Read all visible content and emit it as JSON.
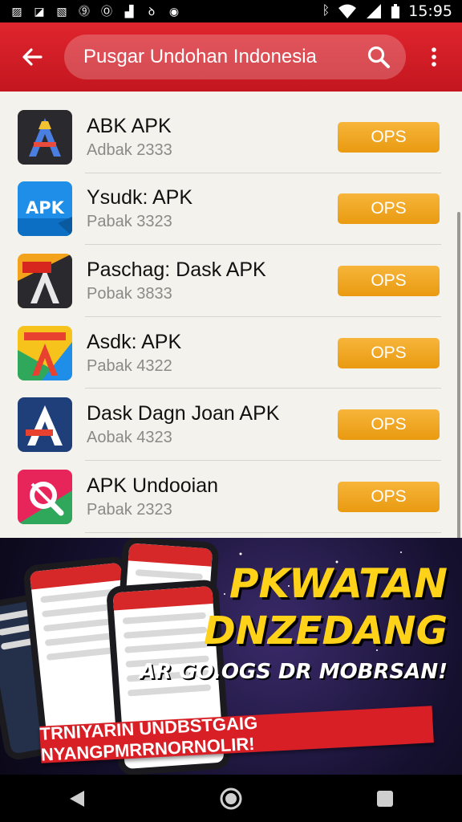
{
  "status_bar": {
    "time": "15:95"
  },
  "app_bar": {
    "search_query": "Pusgar Undohan Indonesia"
  },
  "apps": [
    {
      "name": "ABK APK",
      "subtitle": "Adbak 2333",
      "action": "OPS",
      "icon": "stylized-A-icon"
    },
    {
      "name": "Ysudk: APK",
      "subtitle": "Pabak 3323",
      "action": "OPS",
      "icon": "apk-icon"
    },
    {
      "name": "Paschag: Dask APK",
      "subtitle": "Pobak 3833",
      "action": "OPS",
      "icon": "stylized-A-icon"
    },
    {
      "name": "Asdk: APK",
      "subtitle": "Pabak 4322",
      "action": "OPS",
      "icon": "colorful-A-icon"
    },
    {
      "name": "Dask Dagn Joan APK",
      "subtitle": "Aobak 4323",
      "action": "OPS",
      "icon": "stylized-A-icon"
    },
    {
      "name": "APK Undooian",
      "subtitle": "Pabak 2323",
      "action": "OPS",
      "icon": "search-icon"
    }
  ],
  "banner": {
    "headline_1": "PKWATAN",
    "headline_2": "DNZEDANG",
    "tagline": "AR GO.OGS DR MOBRSAN!",
    "ribbon": "TRNIYARIN UNDBSTGAIG NYANGPMRRNORNOLIR!"
  },
  "colors": {
    "brand_red": "#d62028",
    "button_orange": "#f2a922",
    "list_bg": "#f3f2ed",
    "headline_yellow": "#ffd21a"
  }
}
